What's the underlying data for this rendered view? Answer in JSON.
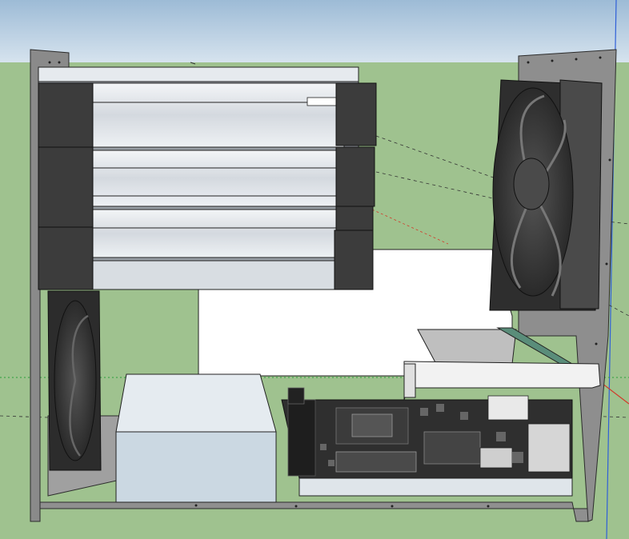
{
  "app": {
    "window_title": "",
    "mode": "3d-modeling-viewport"
  },
  "scene": {
    "subject": "computer-case-model",
    "background_colors": {
      "sky": "#c4d6e6",
      "ground": "#9fc28f"
    },
    "accent_colors": {
      "case_gray": "#8f8f8f",
      "case_edge": "#2b2b2b",
      "fan_black": "#3a3a3a",
      "radiator_light": "#d7dce2",
      "psu_blue_gray": "#cbd8e2",
      "board_black": "#2f2f2f",
      "panel_white": "#ffffff"
    },
    "axes_colors": {
      "red": "#d23a2a",
      "green": "#2a9e3a",
      "blue": "#2f5fd8"
    },
    "objects": [
      "radiator-stack",
      "top-right-fan",
      "left-bottom-fan",
      "power-supply",
      "motherboard",
      "expansion-card",
      "io-bracket",
      "white-back-panel"
    ]
  }
}
